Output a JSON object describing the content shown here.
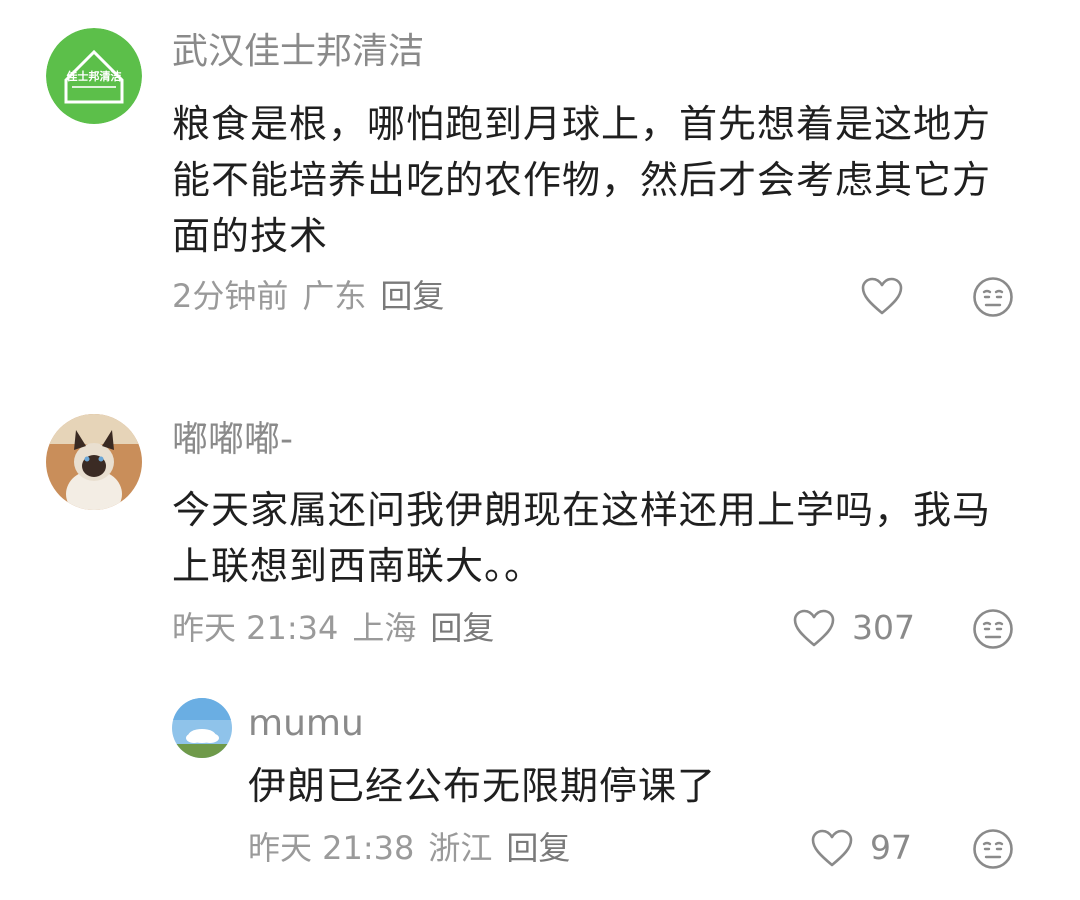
{
  "comments": [
    {
      "author": "武汉佳士邦清洁",
      "avatar_icon": "company-logo-avatar",
      "avatar_logo_text": "佳士邦清洁",
      "content": "粮食是根，哪怕跑到月球上，首先想着是这地方能不能培养出吃的农作物，然后才会考虑其它方面的技术",
      "time": "2分钟前",
      "location": "广东",
      "reply_label": "回复",
      "likes": ""
    },
    {
      "author": "嘟嘟嘟-",
      "avatar_icon": "cat-photo-avatar",
      "content": "今天家属还问我伊朗现在这样还用上学吗，我马上联想到西南联大。。",
      "time": "昨天 21:34",
      "location": "上海",
      "reply_label": "回复",
      "likes": "307",
      "replies": [
        {
          "author": "mumu",
          "avatar_icon": "sky-landscape-avatar",
          "content": "伊朗已经公布无限期停课了",
          "time": "昨天 21:38",
          "location": "浙江",
          "reply_label": "回复",
          "likes": "97"
        }
      ]
    }
  ],
  "icons": {
    "like": "heart-outline-icon",
    "dislike": "neutral-face-icon"
  },
  "colors": {
    "logo_green": "#5cbf4a",
    "text_primary": "#1f1f1f",
    "text_secondary": "#8a8a8a"
  }
}
